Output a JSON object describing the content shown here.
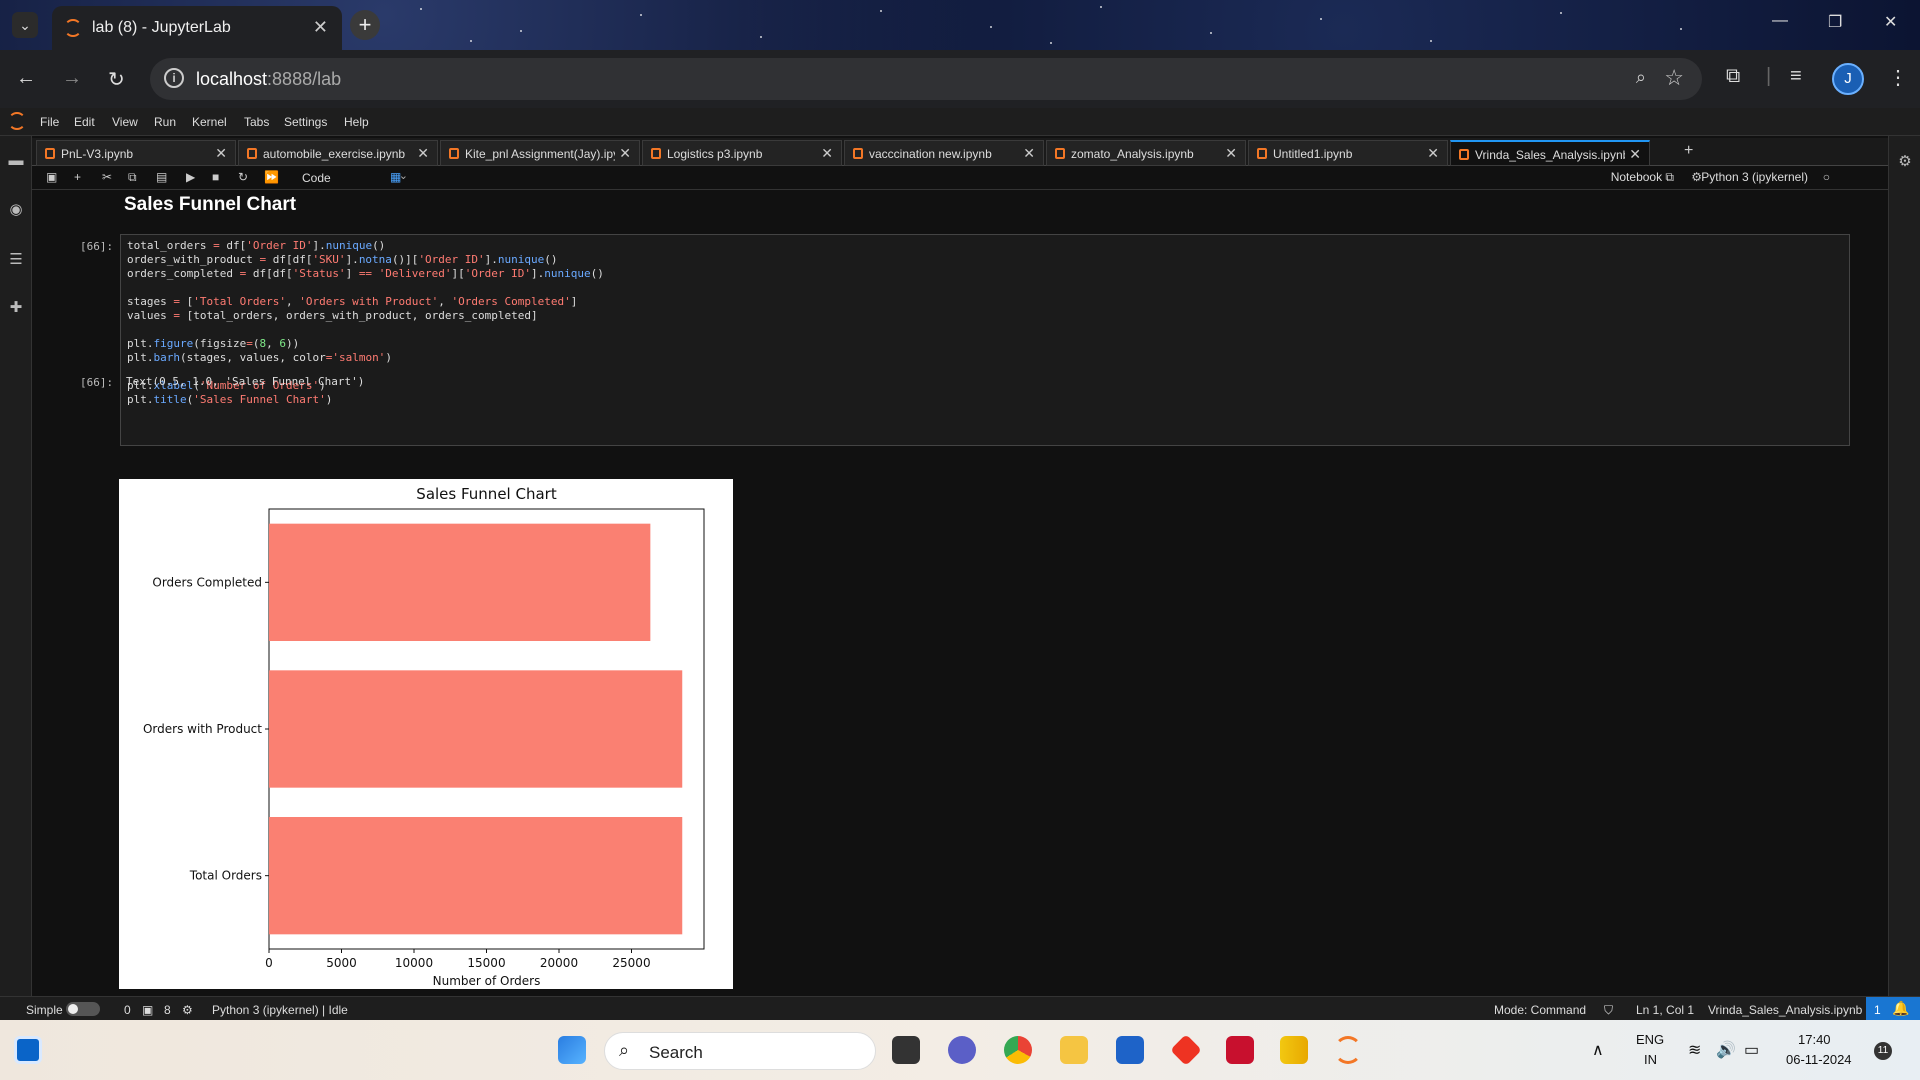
{
  "browser": {
    "tab_title": "lab (8) - JupyterLab",
    "url_host": "localhost",
    "url_rest": ":8888/lab"
  },
  "menu": [
    "File",
    "Edit",
    "View",
    "Run",
    "Kernel",
    "Tabs",
    "Settings",
    "Help"
  ],
  "notebook_tabs": [
    {
      "name": "PnL-V3.ipynb",
      "active": false
    },
    {
      "name": "automobile_exercise.ipynb",
      "active": false
    },
    {
      "name": "Kite_pnl Assignment(Jay).ipynb",
      "active": false
    },
    {
      "name": "Logistics p3.ipynb",
      "active": false
    },
    {
      "name": "vacccination new.ipynb",
      "active": false
    },
    {
      "name": "zomato_Analysis.ipynb",
      "active": false
    },
    {
      "name": "Untitled1.ipynb",
      "active": false
    },
    {
      "name": "Vrinda_Sales_Analysis.ipynb",
      "active": true
    }
  ],
  "toolbar": {
    "cell_type": "Code",
    "notebook_label": "Notebook",
    "kernel": "Python 3 (ipykernel)"
  },
  "notebook": {
    "heading": "Sales Funnel Chart",
    "in_prompt": "[66]:",
    "out_prompt": "[66]:",
    "output_text": "Text(0.5, 1.0, 'Sales Funnel Chart')"
  },
  "chart_data": {
    "type": "bar",
    "orientation": "horizontal",
    "title": "Sales Funnel Chart",
    "xlabel": "Number of Orders",
    "ylabel": "",
    "categories": [
      "Total Orders",
      "Orders with Product",
      "Orders Completed"
    ],
    "values": [
      28500,
      28500,
      26300
    ],
    "xlim": [
      0,
      30000
    ],
    "xticks": [
      0,
      5000,
      10000,
      15000,
      20000,
      25000
    ],
    "color": "#fa8072",
    "grid": false
  },
  "status": {
    "mode_label": "Simple",
    "count_a": "0",
    "count_b": "8",
    "kernel_status": "Python 3 (ipykernel) | Idle",
    "mode": "Mode: Command",
    "cursor": "Ln 1, Col 1",
    "filename": "Vrinda_Sales_Analysis.ipynb",
    "notifications": "1"
  },
  "taskbar": {
    "search_placeholder": "Search",
    "lang_top": "ENG",
    "lang_bottom": "IN",
    "time": "17:40",
    "date": "06-11-2024",
    "badge": "11"
  }
}
